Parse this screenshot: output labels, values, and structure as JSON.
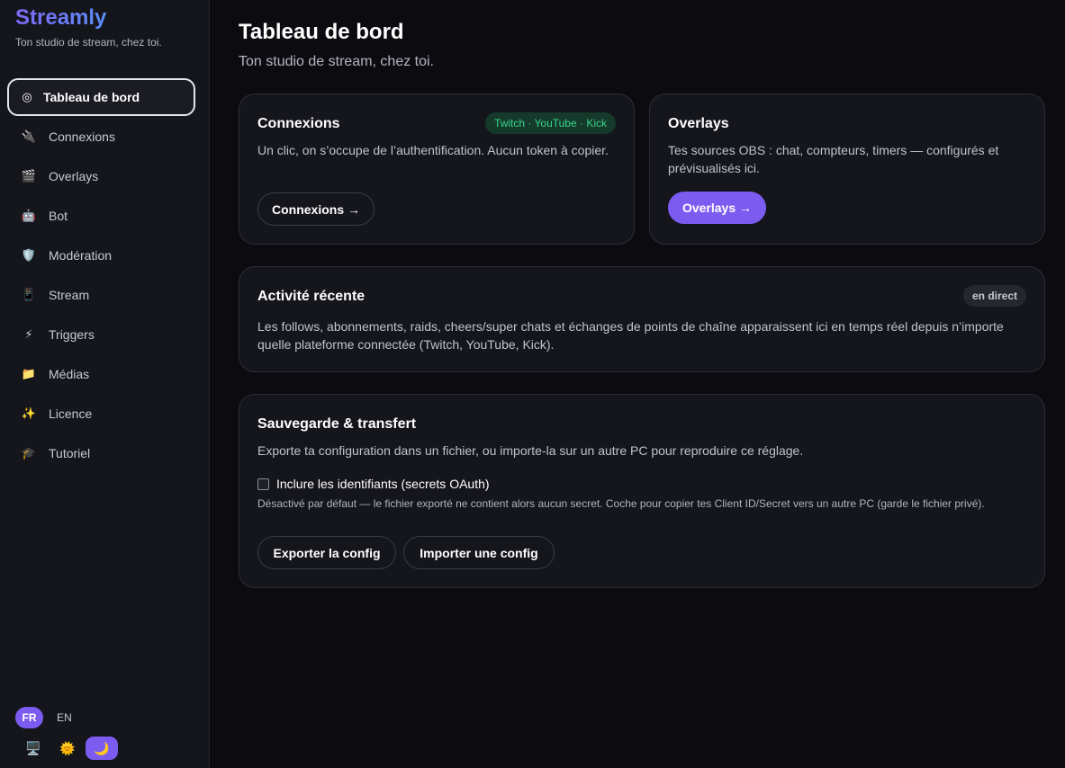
{
  "sidebar": {
    "brand": "Streamly",
    "tagline": "Ton studio de stream, chez toi.",
    "items": [
      {
        "label": "Tableau de bord",
        "icon": "◎"
      },
      {
        "label": "Connexions",
        "icon": "🔌"
      },
      {
        "label": "Overlays",
        "icon": "🎬"
      },
      {
        "label": "Bot",
        "icon": "🤖"
      },
      {
        "label": "Modération",
        "icon": "🛡️"
      },
      {
        "label": "Stream",
        "icon": "📱"
      },
      {
        "label": "Triggers",
        "icon": "⚡"
      },
      {
        "label": "Médias",
        "icon": "📁"
      },
      {
        "label": "Licence",
        "icon": "✨"
      },
      {
        "label": "Tutoriel",
        "icon": "🎓"
      }
    ],
    "lang": {
      "fr": "FR",
      "en": "EN"
    },
    "theme": {
      "system": "🖥️",
      "light": "🌞",
      "dark": "🌙"
    }
  },
  "main": {
    "title": "Tableau de bord",
    "subtitle": "Ton studio de stream, chez toi.",
    "connexions": {
      "title": "Connexions",
      "chip": "Twitch · YouTube · Kick",
      "desc": "Un clic, on s’occupe de l’authentification. Aucun token à copier.",
      "button": "Connexions →"
    },
    "overlays": {
      "title": "Overlays",
      "desc": "Tes sources OBS : chat, compteurs, timers — configurés et prévisualisés ici.",
      "button": "Overlays →"
    },
    "activity": {
      "title": "Activité récente",
      "chip": "en direct",
      "desc": "Les follows, abonnements, raids, cheers/super chats et échanges de points de chaîne apparaissent ici en temps réel depuis n’importe quelle plateforme connectée (Twitch, YouTube, Kick)."
    },
    "backup": {
      "title": "Sauvegarde & transfert",
      "desc": "Exporte ta configuration dans un fichier, ou importe-la sur un autre PC pour reproduire ce réglage.",
      "checkbox_label": "Inclure les identifiants (secrets OAuth)",
      "note": "Désactivé par défaut — le fichier exporté ne contient alors aucun secret. Coche pour copier tes Client ID/Secret vers un autre PC (garde le fichier privé).",
      "export_button": "Exporter la config",
      "import_button": "Importer une config"
    }
  },
  "colors": {
    "accent": "#7c5cf0",
    "background": "#0c0c10",
    "card": "#15151c",
    "chip_green": "#38d488"
  }
}
